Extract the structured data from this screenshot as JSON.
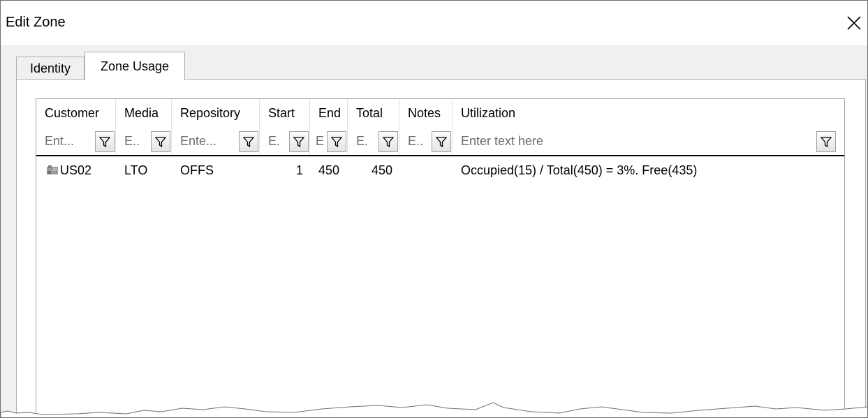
{
  "window": {
    "title": "Edit Zone"
  },
  "tabs": [
    {
      "label": "Identity"
    },
    {
      "label": "Zone Usage"
    }
  ],
  "grid": {
    "columns": [
      {
        "label": "Customer",
        "filter_placeholder": "Ent..."
      },
      {
        "label": "Media",
        "filter_placeholder": "E.."
      },
      {
        "label": "Repository",
        "filter_placeholder": "Ente..."
      },
      {
        "label": "Start",
        "filter_placeholder": "E."
      },
      {
        "label": "End",
        "filter_placeholder": "E"
      },
      {
        "label": "Total",
        "filter_placeholder": "E."
      },
      {
        "label": "Notes",
        "filter_placeholder": "E.."
      },
      {
        "label": "Utilization",
        "filter_placeholder": "Enter text here"
      }
    ],
    "rows": [
      {
        "customer_icon": "customer-icon",
        "customer": "US02",
        "media": "LTO",
        "repository": "OFFS",
        "start": "1",
        "end": "450",
        "total": "450",
        "notes": "",
        "utilization": "Occupied(15) / Total(450) = 3%. Free(435)"
      }
    ]
  },
  "icons": {
    "close": "close-icon",
    "filter": "funnel-icon"
  }
}
